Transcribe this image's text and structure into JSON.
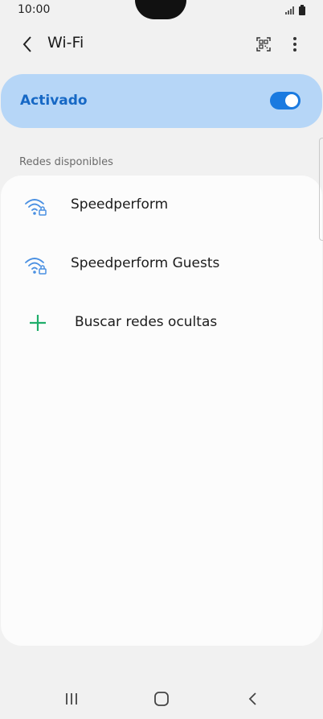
{
  "status_bar": {
    "time": "10:00",
    "icons": [
      "signal-icon",
      "battery-icon"
    ]
  },
  "app_bar": {
    "title": "Wi-Fi",
    "back_icon": "back-arrow-icon",
    "actions": [
      "qr-code-icon",
      "more-options-icon"
    ]
  },
  "master_switch": {
    "label": "Activado",
    "state": "on",
    "accent": "#1a7ae0",
    "label_color": "#1668c5",
    "background": "#b6d6f7"
  },
  "networks": {
    "header": "Redes disponibles",
    "items": [
      {
        "name": "Speedperform",
        "icon": "wifi-lock-icon"
      },
      {
        "name": "Speedperform Guests",
        "icon": "wifi-lock-icon"
      }
    ],
    "add": {
      "label": "Buscar redes ocultas",
      "icon": "plus-icon",
      "color": "#1fae6a"
    }
  },
  "nav_bar": {
    "buttons": [
      "recent-apps-icon",
      "home-icon",
      "back-icon"
    ]
  }
}
